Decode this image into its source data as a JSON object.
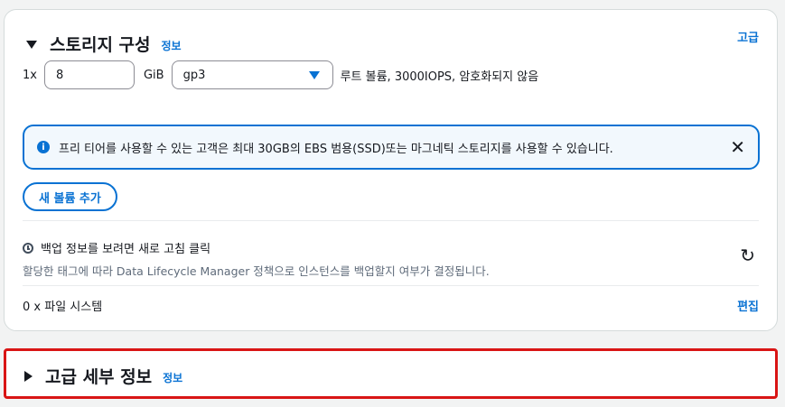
{
  "storage": {
    "title": "스토리지 구성",
    "info_label": "정보",
    "advanced_label": "고급",
    "multiplier": "1x",
    "size_value": "8",
    "size_unit": "GiB",
    "volume_type": "gp3",
    "volume_desc": "루트 볼륨,  3000IOPS,  암호화되지 않음",
    "alert": {
      "icon": "info-icon",
      "text": "프리 티어를 사용할 수 있는 고객은 최대 30GB의 EBS 범용(SSD)또는 마그네틱 스토리지를 사용할 수 있습니다.",
      "close": "✕"
    },
    "add_volume_label": "새 볼륨 추가",
    "backup": {
      "title": "백업 정보를 보려면 새로 고침 클릭",
      "subtitle": "할당한 태그에 따라 Data Lifecycle Manager 정책으로 인스턴스를 백업할지 여부가 결정됩니다.",
      "refresh_icon": "↻"
    },
    "filesystems": "0 x 파일 시스템",
    "edit_label": "편집"
  },
  "advanced_details": {
    "title": "고급 세부 정보",
    "info_label": "정보"
  },
  "colors": {
    "accent": "#0972d3",
    "highlight_border": "#d91515"
  }
}
